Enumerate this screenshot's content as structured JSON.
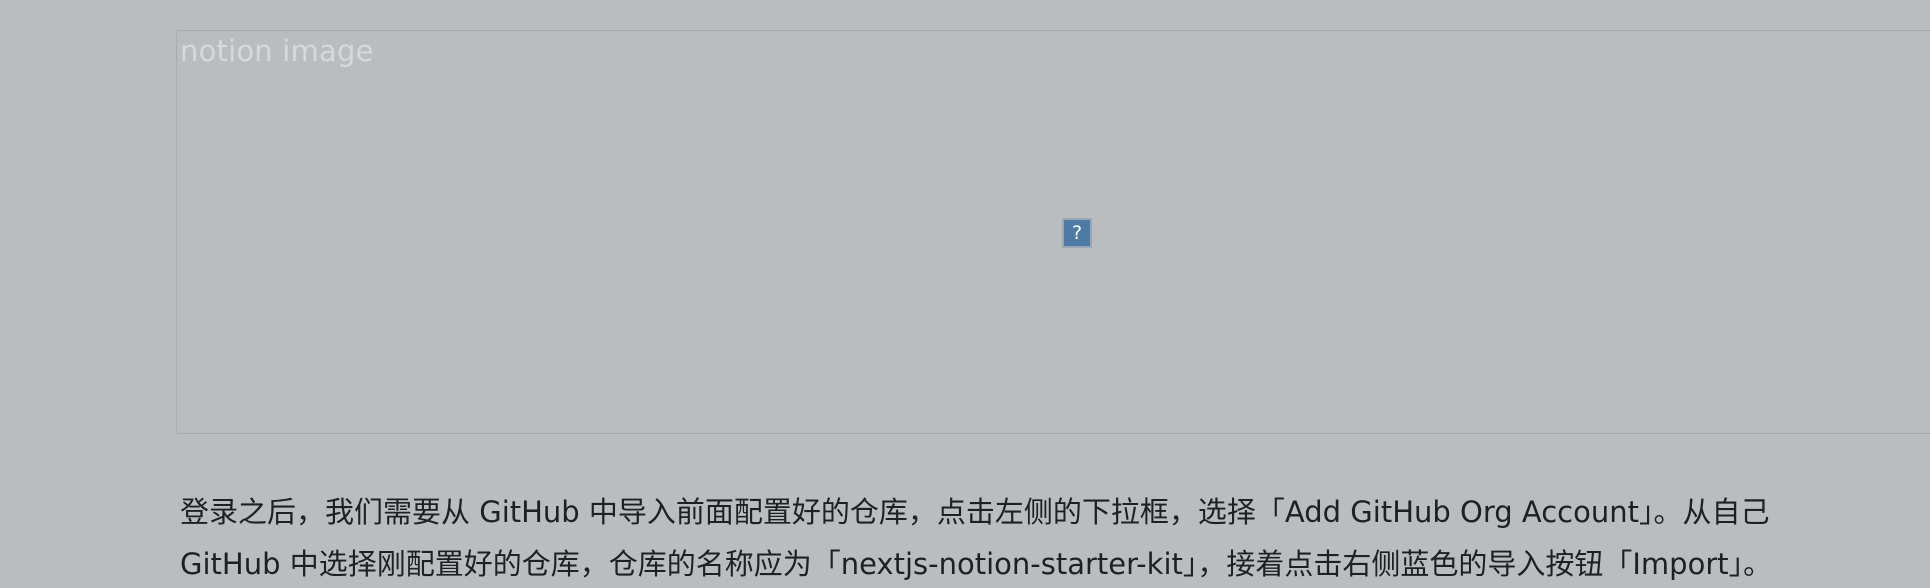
{
  "image": {
    "alt_text": "notion image",
    "broken_icon_glyph": "?"
  },
  "paragraph": {
    "line1": "登录之后，我们需要从 GitHub 中导入前面配置好的仓库，点击左侧的下拉框，选择「Add GitHub Org Account」。从自己",
    "line2": "GitHub 中选择刚配置好的仓库，仓库的名称应为「nextjs-notion-starter-kit」，接着点击右侧蓝色的导入按钮「Import」。"
  },
  "colors": {
    "background": "#babdc0",
    "text": "#1f2022",
    "broken_icon": "#4e7aa6"
  }
}
